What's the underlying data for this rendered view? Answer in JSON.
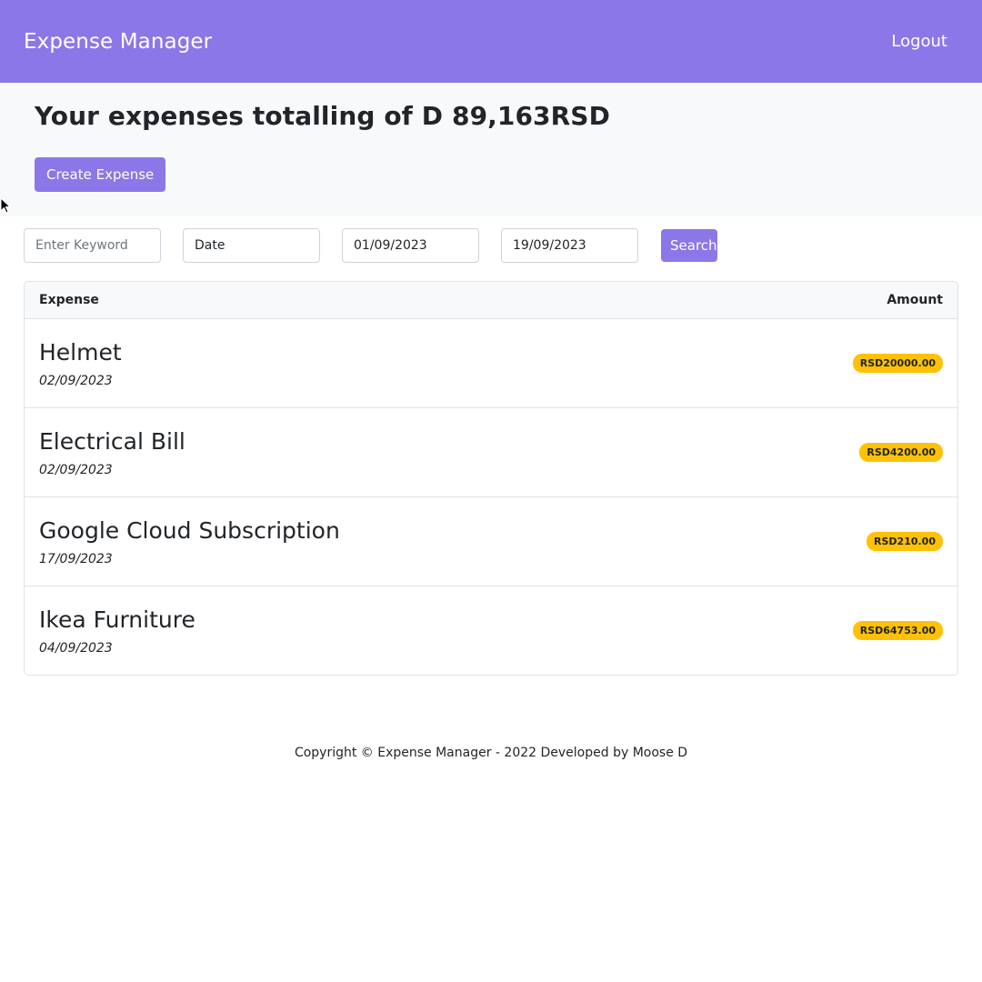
{
  "theme": {
    "accent": "#8c77e8",
    "badge": "#ffc107"
  },
  "nav": {
    "brand": "Expense Manager",
    "logout": "Logout"
  },
  "hero": {
    "title": "Your expenses totalling of D 89,163RSD",
    "create_button": "Create Expense"
  },
  "filters": {
    "keyword_placeholder": "Enter Keyword",
    "sort_value": "Date",
    "start_date": "01/09/2023",
    "end_date": "19/09/2023",
    "search_label": "Search"
  },
  "table": {
    "headers": {
      "expense": "Expense",
      "amount": "Amount"
    },
    "rows": [
      {
        "name": "Helmet",
        "date": "02/09/2023",
        "amount": "RSD20000.00"
      },
      {
        "name": "Electrical Bill",
        "date": "02/09/2023",
        "amount": "RSD4200.00"
      },
      {
        "name": "Google Cloud Subscription",
        "date": "17/09/2023",
        "amount": "RSD210.00"
      },
      {
        "name": "Ikea Furniture",
        "date": "04/09/2023",
        "amount": "RSD64753.00"
      }
    ]
  },
  "footer": {
    "text": "Copyright © Expense Manager - 2022 Developed by Moose D"
  }
}
